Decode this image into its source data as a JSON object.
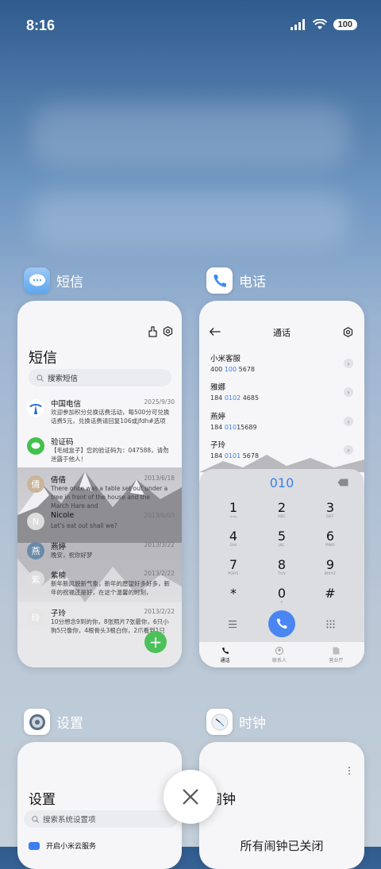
{
  "status_bar": {
    "time": "8:16",
    "battery": "100"
  },
  "apps": {
    "messages": {
      "label": "短信"
    },
    "phone": {
      "label": "电话"
    },
    "settings": {
      "label": "设置"
    },
    "clock": {
      "label": "时钟"
    }
  },
  "sms": {
    "title": "短信",
    "search_placeholder": "搜索短信",
    "items": [
      {
        "name": "中国电信",
        "date": "2025/9/30",
        "preview": "欢迎参加积分兑换话费活动，每500分可兑换话费5元，兑换话费请回复106或jfdh#选项"
      },
      {
        "name": "验证码",
        "date": "",
        "preview": "【毛绒盒子】您的验证码为：047588，请勿泄露于他人！"
      },
      {
        "name": "倩倩",
        "date": "2013/6/18",
        "preview": "There once was a table set out under a tree in front of the house and the March Hare and"
      },
      {
        "name": "Nicole",
        "date": "2013/6/03",
        "preview": "Let's eat out shall we?"
      },
      {
        "name": "燕婷",
        "date": "2013/3/22",
        "preview": "晚安，祝你好梦"
      },
      {
        "name": "紫楠",
        "date": "2013/2/22",
        "preview": "新年新风貌新气象，新年的愿望好多好多，新年的祝福还是好，在这个温馨的时刻，"
      },
      {
        "name": "子玲",
        "date": "2013/2/22",
        "preview": "10分想念9到的你，8张照片7张最你，6只小狗5只像你，4根骨头3根白你，2爪看到1只"
      }
    ]
  },
  "phone": {
    "title": "通话",
    "contacts": [
      {
        "name": "小米客服",
        "num_a": "400 ",
        "num_hl": "100",
        "num_b": " 5678"
      },
      {
        "name": "雅娜",
        "num_a": "184 ",
        "num_hl": "0102",
        "num_b": " 4685"
      },
      {
        "name": "燕婷",
        "num_a": "184 ",
        "num_hl": "010",
        "num_b": "15689"
      },
      {
        "name": "子玲",
        "num_a": "184 ",
        "num_hl": "0101",
        "num_b": " 5678"
      }
    ],
    "dial_input": "010",
    "keys": [
      {
        "d": "1",
        "l": "ထထ"
      },
      {
        "d": "2",
        "l": "ABC"
      },
      {
        "d": "3",
        "l": "DEF"
      },
      {
        "d": "4",
        "l": "GHI"
      },
      {
        "d": "5",
        "l": "JKL"
      },
      {
        "d": "6",
        "l": "MNO"
      },
      {
        "d": "7",
        "l": "PQRS"
      },
      {
        "d": "8",
        "l": "TUV"
      },
      {
        "d": "9",
        "l": "WXYZ"
      },
      {
        "d": "*",
        "l": ""
      },
      {
        "d": "0",
        "l": "+"
      },
      {
        "d": "#",
        "l": ""
      }
    ],
    "tabs": [
      "通话",
      "联系人",
      "营业厅"
    ]
  },
  "settings": {
    "title": "设置",
    "search_placeholder": "搜索系统设置项",
    "first_item": "开启小米云服务"
  },
  "clock": {
    "title": "闹钟",
    "empty_text": "所有闹钟已关闭"
  },
  "colors": {
    "accent_blue": "#3c7ef0",
    "fab_green": "#4cc15a",
    "call_blue": "#4a86f2"
  }
}
